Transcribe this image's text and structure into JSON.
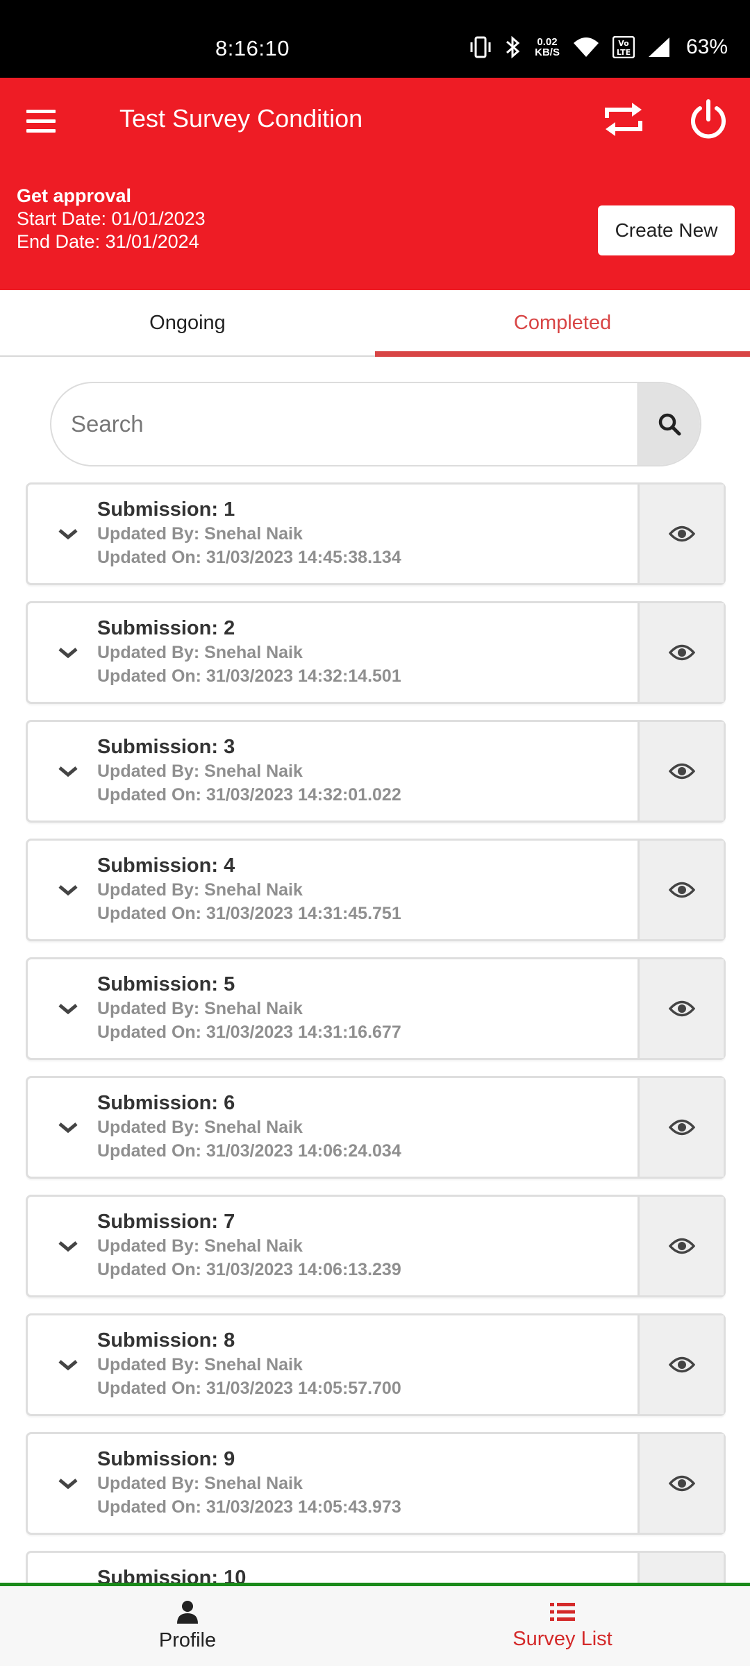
{
  "status_bar": {
    "time": "8:16:10",
    "net_speed_value": "0.02",
    "net_speed_unit": "KB/S",
    "volte": "Vo LTE",
    "battery": "63%"
  },
  "app_bar": {
    "title": "Test Survey Condition",
    "approval_title": "Get approval",
    "start_date": "Start Date: 01/01/2023",
    "end_date": "End Date: 31/01/2024",
    "create_button": "Create New",
    "color": "#ee1c25"
  },
  "tabs": [
    {
      "label": "Ongoing",
      "active": false
    },
    {
      "label": "Completed",
      "active": true
    }
  ],
  "search": {
    "placeholder": "Search",
    "value": ""
  },
  "submissions": [
    {
      "title": "Submission: 1",
      "updated_by": "Updated By: Snehal Naik",
      "updated_on": "Updated On: 31/03/2023 14:45:38.134"
    },
    {
      "title": "Submission: 2",
      "updated_by": "Updated By: Snehal Naik",
      "updated_on": "Updated On: 31/03/2023 14:32:14.501"
    },
    {
      "title": "Submission: 3",
      "updated_by": "Updated By: Snehal Naik",
      "updated_on": "Updated On: 31/03/2023 14:32:01.022"
    },
    {
      "title": "Submission: 4",
      "updated_by": "Updated By: Snehal Naik",
      "updated_on": "Updated On: 31/03/2023 14:31:45.751"
    },
    {
      "title": "Submission: 5",
      "updated_by": "Updated By: Snehal Naik",
      "updated_on": "Updated On: 31/03/2023 14:31:16.677"
    },
    {
      "title": "Submission: 6",
      "updated_by": "Updated By: Snehal Naik",
      "updated_on": "Updated On: 31/03/2023 14:06:24.034"
    },
    {
      "title": "Submission: 7",
      "updated_by": "Updated By: Snehal Naik",
      "updated_on": "Updated On: 31/03/2023 14:06:13.239"
    },
    {
      "title": "Submission: 8",
      "updated_by": "Updated By: Snehal Naik",
      "updated_on": "Updated On: 31/03/2023 14:05:57.700"
    },
    {
      "title": "Submission: 9",
      "updated_by": "Updated By: Snehal Naik",
      "updated_on": "Updated On: 31/03/2023 14:05:43.973"
    },
    {
      "title": "Submission: 10",
      "updated_by": "",
      "updated_on": ""
    }
  ],
  "bottom_nav": [
    {
      "label": "Profile",
      "icon": "person-icon",
      "active": false
    },
    {
      "label": "Survey List",
      "icon": "list-icon",
      "active": true
    }
  ],
  "colors": {
    "accent_red": "#ee1c25",
    "tab_active": "#d84545",
    "nav_border": "#1a8a1a"
  }
}
